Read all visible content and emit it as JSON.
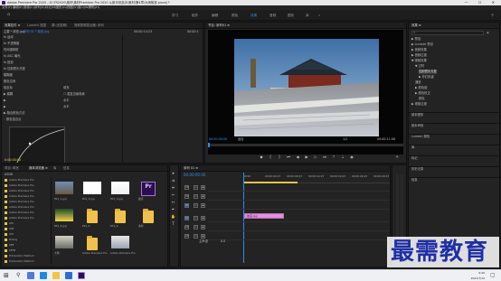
{
  "window": {
    "title": "Adobe Premiere Pro 2020 - D:\\TR2020\\素材\\素材Premiere Pro 2020 从新手到高手\\素材\\第4章\\大雨故宫.prproj *",
    "controls": "— ☐ ✕"
  },
  "menu": [
    "文件(F)",
    "编辑(E)",
    "剪辑(C)",
    "序列(S)",
    "标记(M)",
    "图形(G)",
    "视图(V)",
    "窗口(W)",
    "帮助(H)"
  ],
  "workspaces": {
    "items": [
      "学习",
      "组件",
      "编辑",
      "颜色",
      "效果",
      "音频",
      "图形",
      "库"
    ],
    "active_index": 4
  },
  "effect_controls": {
    "tabs": [
      "效果控件 ≡",
      "Lumetri 范围",
      "源:(无剪辑)",
      "音频剪辑混合器: 序列"
    ],
    "source_label": "主要 * 故宫.jpg",
    "clip_label": "序列 01 * 故宫.jpg",
    "timecode_1": "00:00:14:23",
    "timecode_2": "00:00:1",
    "rows": [
      {
        "label": "fx  运动"
      },
      {
        "label": "fx  不透明度"
      },
      {
        "label": "    时间重映射"
      },
      {
        "label": "fx  ASC 曝光"
      },
      {
        "label": "fx  投影"
      },
      {
        "label": "fx  控制镜头光晕"
      },
      {
        "label": "    模糊度",
        "value": ""
      },
      {
        "label": "    颜色空间"
      },
      {
        "label": "        极坐标",
        "value": "填充"
      },
      {
        "label": "        ▶ 模糊",
        "value": "☐ 重复边缘像素"
      },
      {
        "label": "        ▶",
        "value": "水平"
      },
      {
        "label": "        ▶",
        "value": "水平"
      },
      {
        "label": "    ▶ 融合颜色方法"
      },
      {
        "label": "    ◦ 颜色混合点"
      }
    ],
    "time_display": "0:00:00:00"
  },
  "program": {
    "tabs": [
      "节目: 序列01 ≡"
    ],
    "current_time": "00:00:00:00",
    "fit": "适合",
    "ratio": "1/2",
    "duration": "00:00:11:08"
  },
  "project": {
    "tabs": [
      "项目: 故宫",
      "媒体浏览器 ≡",
      "库",
      "信息"
    ],
    "path_label": "ASD8",
    "folders": [
      "Adobe Premiere Pro",
      "Adobe Premiere Pro",
      "Adobe Premiere Pro",
      "Adobe Premiere Pro",
      "Adobe Premiere Pro",
      "Adobe Premiere Pro",
      "Adobe Premiere Pro",
      "Adobe Premiere Pro",
      "ATA",
      "ATB",
      "ATC",
      "Debug",
      "KEE",
      "KEYB",
      "Pr4Custom Platform",
      "Pr4Custom Platform"
    ],
    "items": [
      {
        "name": "P01_1.jpg",
        "kind": "photo-palace"
      },
      {
        "name": "P01_2.jpg",
        "kind": "photo-snow"
      },
      {
        "name": "P01_3.jpg",
        "kind": "photo-blank"
      },
      {
        "name": "故宫",
        "kind": "premiere"
      },
      {
        "name": "P01_4.jpg",
        "kind": "photo-yellow"
      },
      {
        "name": "P01_5",
        "kind": "folder"
      },
      {
        "name": "P01_6",
        "kind": "folder"
      },
      {
        "name": "素材",
        "kind": "folder"
      },
      {
        "name": "大雨",
        "kind": "photo-street"
      },
      {
        "name": "Adobe Premiere Pro",
        "kind": "folder-open"
      },
      {
        "name": "Adobe Premiere Pro",
        "kind": "photo-group"
      }
    ]
  },
  "timeline": {
    "tabs": [
      "序列 01 ≡"
    ],
    "current_time": "00:00:00:00",
    "ruler": [
      "00:00",
      "00:00:04:23",
      "00:00:09:23",
      "00:00:14:23",
      "00:00:19:23",
      "00:00:24:23",
      "00:00:29:23"
    ],
    "tracks": [
      "V3",
      "V2",
      "V1",
      "A1",
      "A2",
      "A3"
    ],
    "clip_label": "故宫.jpg",
    "master": "主声道",
    "master_value": "0.0"
  },
  "effects": {
    "tabs": [
      "效果 ≡"
    ],
    "search_placeholder": "",
    "tree": [
      {
        "label": "▶ 预设",
        "depth": 0
      },
      {
        "label": "▶ Lumetri 预设",
        "depth": 0
      },
      {
        "label": "▶ 音频效果",
        "depth": 0
      },
      {
        "label": "▶ 音频过渡",
        "depth": 0
      },
      {
        "label": "▼ 视频效果",
        "depth": 0
      },
      {
        "label": "▼ 过时",
        "depth": 1
      },
      {
        "label": "   控制镜头光晕",
        "depth": 2,
        "selected": true
      },
      {
        "label": "   ▶ 非红色键",
        "depth": 2
      },
      {
        "label": "   通道",
        "depth": 1
      },
      {
        "label": "   ▶ 颜色键",
        "depth": 1
      },
      {
        "label": "   ▶ 颜色校正",
        "depth": 1
      },
      {
        "label": "   颜色",
        "depth": 2
      },
      {
        "label": "▶ 视频过渡",
        "depth": 0
      }
    ],
    "sections": [
      "基本图形",
      "基本声音",
      "Lumetri 颜色",
      "库",
      "标记",
      "历史记录",
      "信息"
    ]
  },
  "watermark": "最需教育",
  "taskbar": {
    "time": "9:40",
    "date": "2021/7/12"
  },
  "colors": {
    "accent": "#2d8ceb",
    "clip": "#e38fe0",
    "timecode": "#2d8ceb",
    "premiere": "#2d0d4e",
    "watermark": "#1f2fa6"
  }
}
